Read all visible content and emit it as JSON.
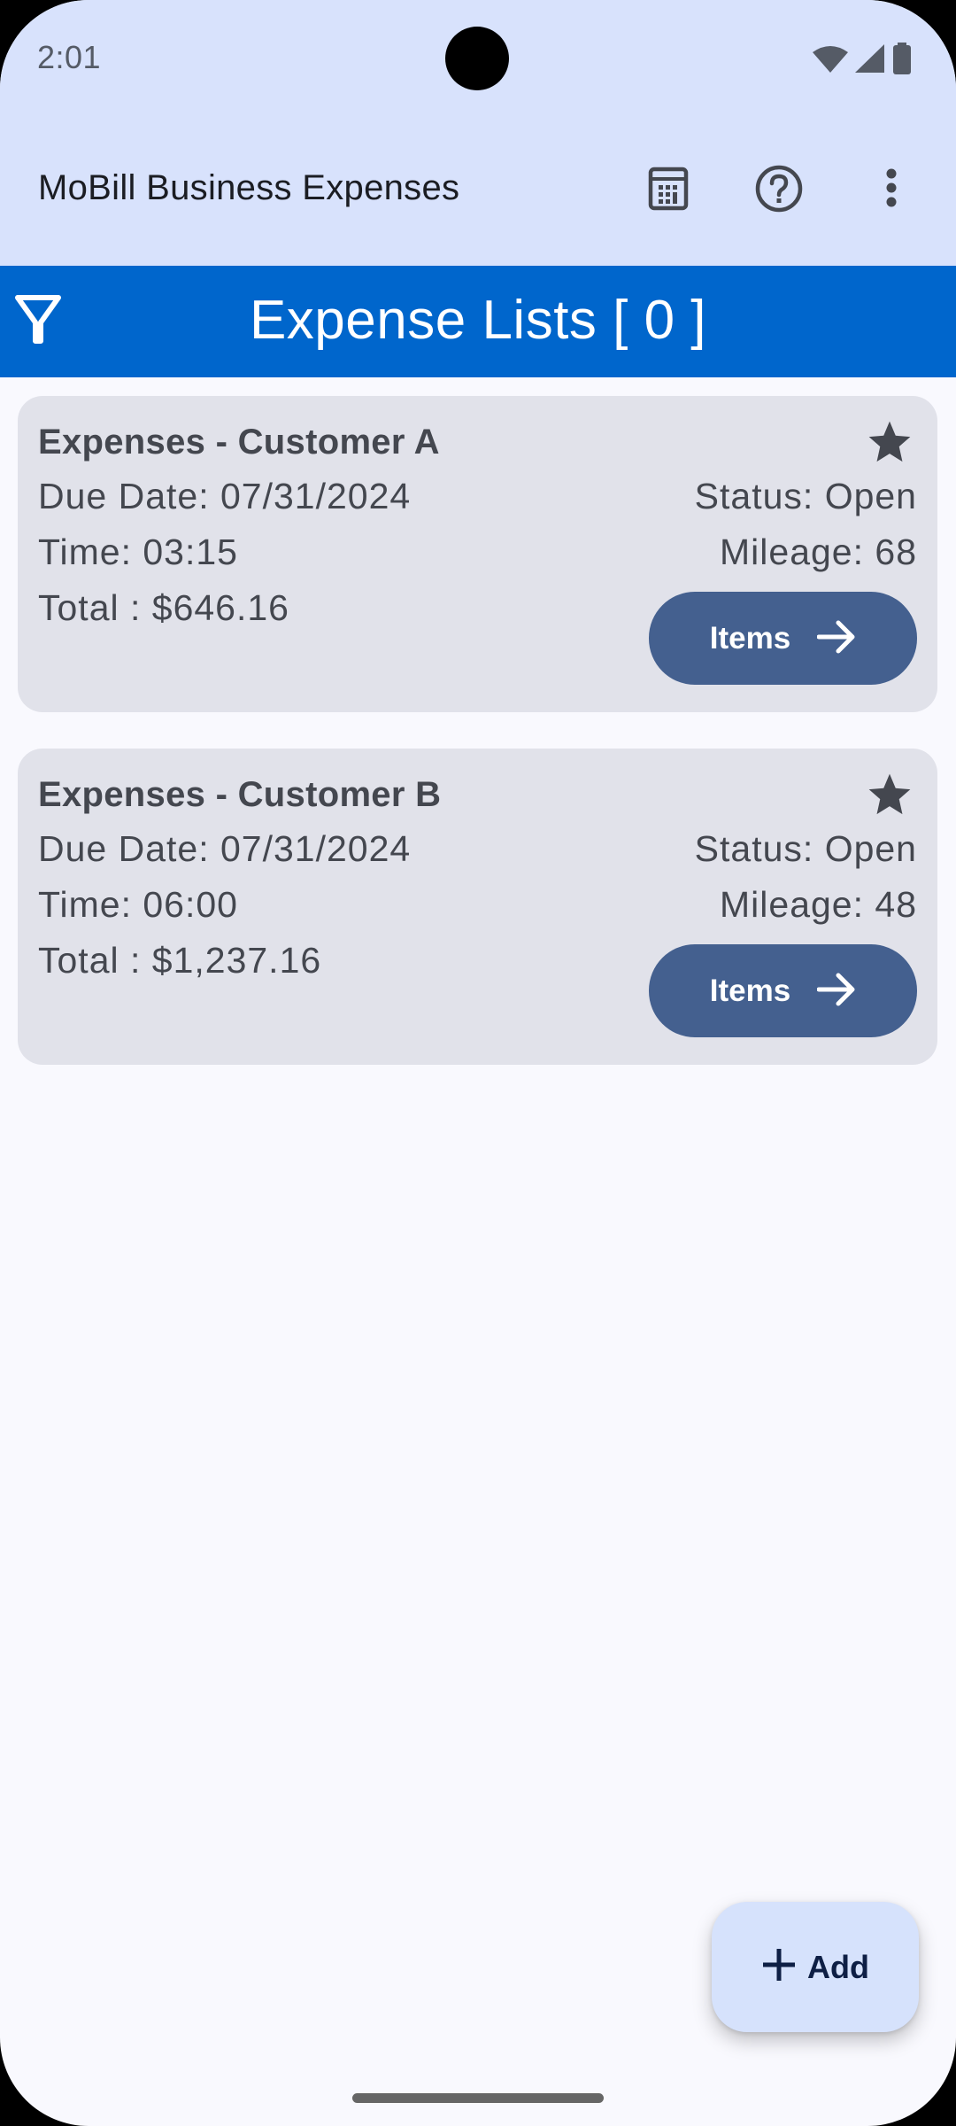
{
  "status_bar": {
    "time": "2:01",
    "icons": [
      "wifi-icon",
      "cell-signal-icon",
      "battery-icon"
    ]
  },
  "app_bar": {
    "title": "MoBill Business Expenses",
    "actions": [
      {
        "name": "calculator",
        "icon": "calculator-icon"
      },
      {
        "name": "help",
        "icon": "help-circle-icon"
      },
      {
        "name": "more",
        "icon": "more-vert-icon"
      }
    ]
  },
  "list_header": {
    "title": "Expense Lists [ 0 ]",
    "filter_icon": "filter-icon"
  },
  "expense_lists": [
    {
      "title": "Expenses - Customer A",
      "due_date": "Due Date: 07/31/2024",
      "time": "Time: 03:15",
      "total": "Total : $646.16",
      "status": "Status: Open",
      "mileage": "Mileage: 68",
      "starred": true,
      "items_button": "Items"
    },
    {
      "title": "Expenses - Customer B",
      "due_date": "Due Date: 07/31/2024",
      "time": "Time: 06:00",
      "total": "Total : $1,237.16",
      "status": "Status: Open",
      "mileage": "Mileage: 48",
      "starred": true,
      "items_button": "Items"
    }
  ],
  "fab": {
    "label": "Add",
    "icon": "plus-icon"
  },
  "colors": {
    "top_bar_bg": "#d8e2fc",
    "header_bg": "#0066cc",
    "card_bg": "#e1e2ea",
    "button_bg": "#44608f",
    "fab_bg": "#d6e2fc",
    "page_bg": "#f9f9fe",
    "text": "#44474f"
  }
}
